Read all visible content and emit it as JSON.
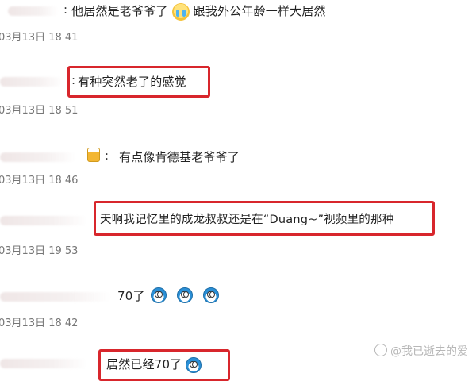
{
  "comments": [
    {
      "text_a": "他居然是老爷爷了",
      "emoji_a": "crying-face",
      "text_b": "跟我外公年龄一样大居然",
      "time": "03月13日 18 41"
    },
    {
      "text": "有种突然老了的感觉",
      "time": "03月13日 18 51"
    },
    {
      "user_fragment": "_Run",
      "emoji": "beer-mug",
      "text": "有点像肯德基老爷爷了",
      "time": "03月13日 18 46"
    },
    {
      "text": "天啊我记忆里的成龙叔叔还是在“Duang~”视频里的那种",
      "time": "03月13日 19 53"
    },
    {
      "text": "70了",
      "emojis": [
        "doraemon-face",
        "doraemon-face",
        "doraemon-face"
      ],
      "time": "03月13日 18 42"
    },
    {
      "text": "居然已经70了",
      "emoji": "doraemon-face"
    }
  ],
  "separator": ":",
  "highlight_color": "#d8262c",
  "watermark": "@我已逝去的爱"
}
